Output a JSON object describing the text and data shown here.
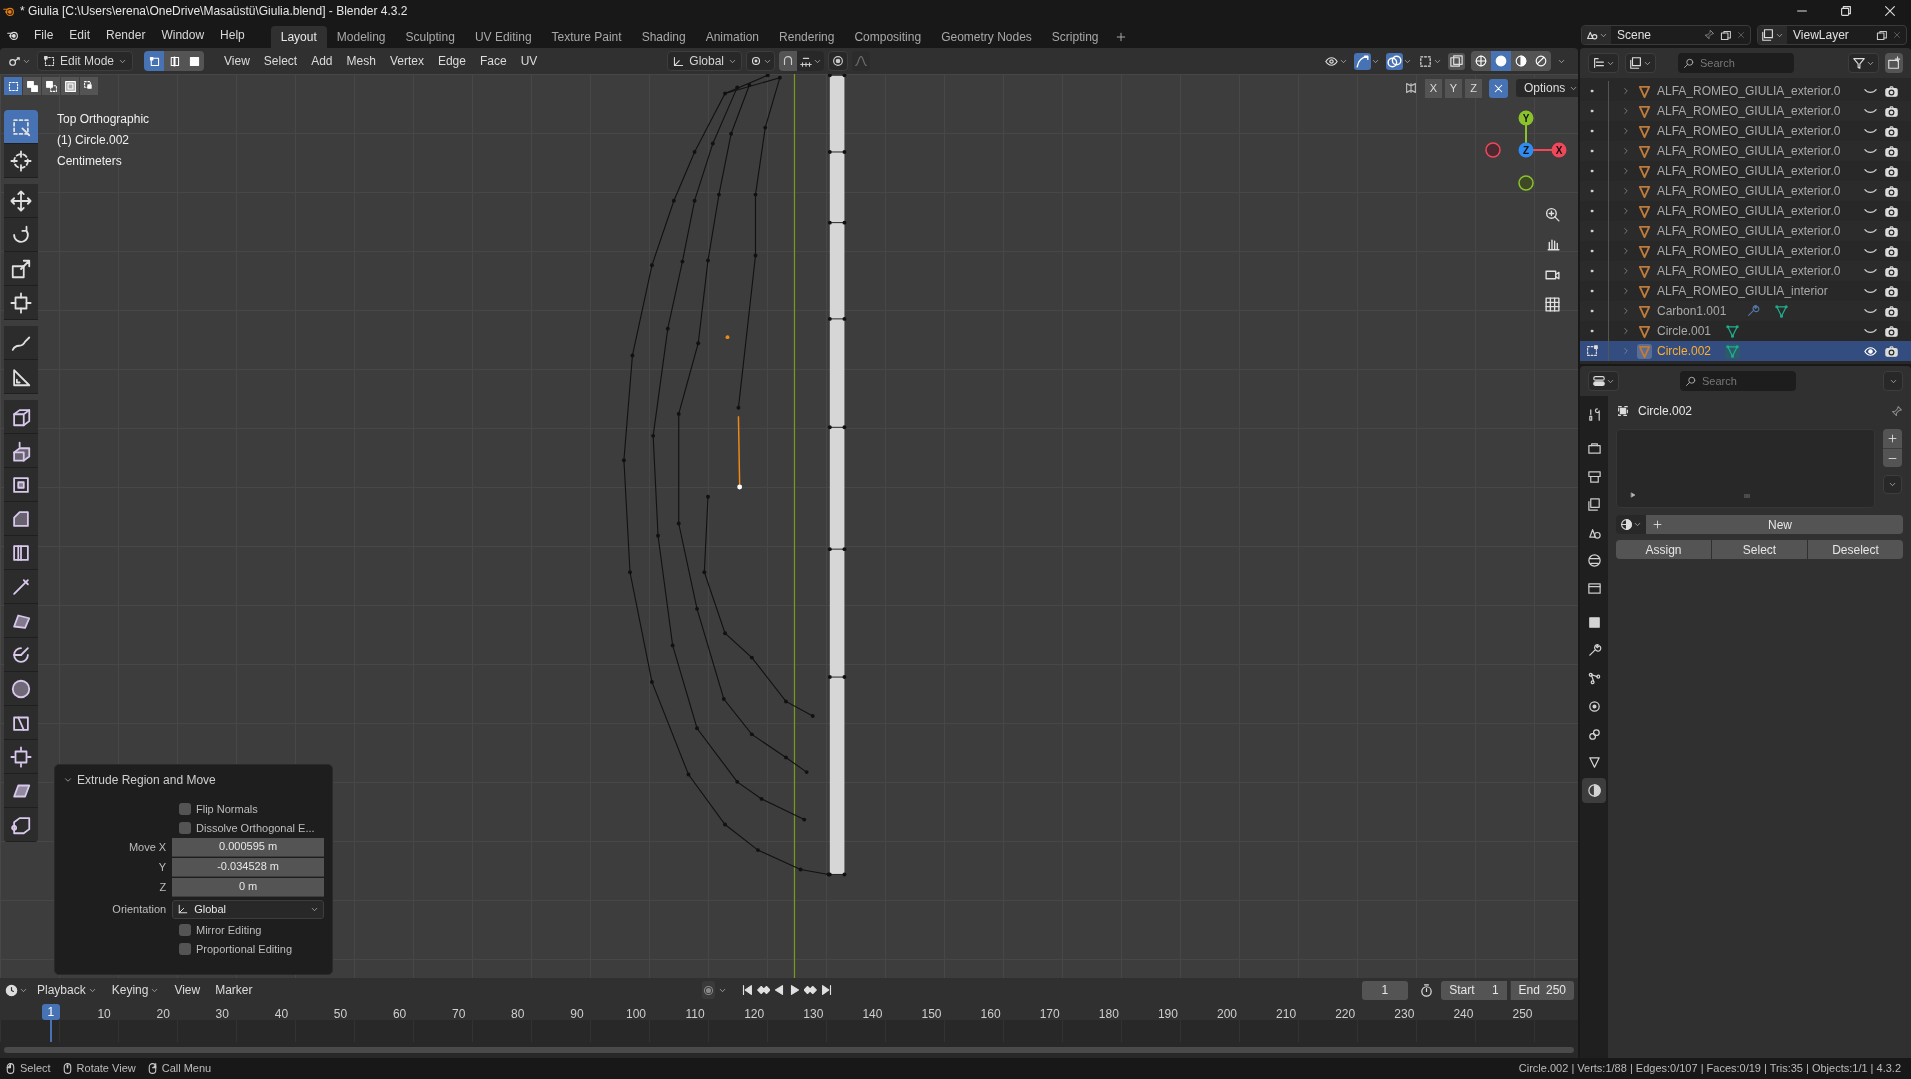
{
  "window": {
    "title": "* Giulia [C:\\Users\\erena\\OneDrive\\Masaüstü\\Giulia.blend] - Blender 4.3.2"
  },
  "menu": [
    "File",
    "Edit",
    "Render",
    "Window",
    "Help"
  ],
  "workspaces": [
    {
      "label": "Layout",
      "selected": true
    },
    {
      "label": "Modeling",
      "selected": false
    },
    {
      "label": "Sculpting",
      "selected": false
    },
    {
      "label": "UV Editing",
      "selected": false
    },
    {
      "label": "Texture Paint",
      "selected": false
    },
    {
      "label": "Shading",
      "selected": false
    },
    {
      "label": "Animation",
      "selected": false
    },
    {
      "label": "Rendering",
      "selected": false
    },
    {
      "label": "Compositing",
      "selected": false
    },
    {
      "label": "Geometry Nodes",
      "selected": false
    },
    {
      "label": "Scripting",
      "selected": false
    }
  ],
  "scene": "Scene",
  "view_layer": "ViewLayer",
  "viewport_header": {
    "mode": "Edit Mode",
    "select_modes": [
      {
        "selected": true
      },
      {
        "selected": false
      },
      {
        "selected": false
      }
    ],
    "menus": [
      "View",
      "Select",
      "Add",
      "Mesh",
      "Vertex",
      "Edge",
      "Face",
      "UV"
    ],
    "orientation": "Global",
    "shading_modes": [
      {
        "selected": false
      },
      {
        "selected": true
      },
      {
        "selected": false
      },
      {
        "selected": false
      }
    ]
  },
  "viewport": {
    "overlay": [
      "Top Orthographic",
      "(1) Circle.002",
      "Centimeters"
    ],
    "gizmo_axes": [
      "Y",
      "Z",
      "X"
    ],
    "mirror_axes": [
      "X",
      "Y",
      "Z"
    ],
    "options": "Options"
  },
  "toolbar": [
    {
      "selected": true
    },
    {
      "selected": false
    },
    {
      "selected": false
    },
    {
      "selected": false
    },
    {
      "selected": false
    },
    {
      "selected": false
    },
    {
      "selected": false
    },
    {
      "selected": false
    },
    {
      "selected": false
    },
    {
      "selected": false
    },
    {
      "selected": false
    },
    {
      "selected": false
    },
    {
      "selected": false
    },
    {
      "selected": false
    },
    {
      "selected": false
    },
    {
      "selected": false
    },
    {
      "selected": false
    },
    {
      "selected": false
    },
    {
      "selected": false
    },
    {
      "selected": false
    },
    {
      "selected": false
    }
  ],
  "operator_panel": {
    "title": "Extrude Region and Move",
    "expanded": true,
    "options": [
      {
        "kind": "checkbox",
        "label": "Flip Normals",
        "checked": false
      },
      {
        "kind": "checkbox",
        "label": "Dissolve Orthogonal E...",
        "checked": false
      },
      {
        "kind": "number",
        "label": "Move X",
        "value": "0.000595 m"
      },
      {
        "kind": "number",
        "label": "Y",
        "value": "-0.034528 m"
      },
      {
        "kind": "number",
        "label": "Z",
        "value": "0 m"
      },
      {
        "kind": "dropdown",
        "label": "Orientation",
        "value": "Global"
      },
      {
        "kind": "checkbox",
        "label": "Mirror Editing",
        "checked": false
      },
      {
        "kind": "checkbox",
        "label": "Proportional Editing",
        "checked": false
      }
    ]
  },
  "outliner": {
    "search": {
      "placeholder": "Search"
    },
    "rows": [
      {
        "name": "ALFA_ROMEO_GIULIA_exterior.0",
        "selected": false,
        "icons": []
      },
      {
        "name": "ALFA_ROMEO_GIULIA_exterior.0",
        "selected": false,
        "icons": []
      },
      {
        "name": "ALFA_ROMEO_GIULIA_exterior.0",
        "selected": false,
        "icons": []
      },
      {
        "name": "ALFA_ROMEO_GIULIA_exterior.0",
        "selected": false,
        "icons": []
      },
      {
        "name": "ALFA_ROMEO_GIULIA_exterior.0",
        "selected": false,
        "icons": []
      },
      {
        "name": "ALFA_ROMEO_GIULIA_exterior.0",
        "selected": false,
        "icons": []
      },
      {
        "name": "ALFA_ROMEO_GIULIA_exterior.0",
        "selected": false,
        "icons": []
      },
      {
        "name": "ALFA_ROMEO_GIULIA_exterior.0",
        "selected": false,
        "icons": []
      },
      {
        "name": "ALFA_ROMEO_GIULIA_exterior.0",
        "selected": false,
        "icons": []
      },
      {
        "name": "ALFA_ROMEO_GIULIA_exterior.0",
        "selected": false,
        "icons": []
      },
      {
        "name": "ALFA_ROMEO_GIULIA_interior",
        "selected": false,
        "icons": []
      },
      {
        "name": "Carbon1.001",
        "selected": false,
        "icons": [
          {
            "kind": "modifier"
          },
          {
            "kind": "mesh"
          }
        ]
      },
      {
        "name": "Circle.001",
        "selected": false,
        "icons": [
          {
            "kind": "mesh"
          }
        ]
      },
      {
        "name": "Circle.002",
        "selected": true,
        "icons": [
          {
            "kind": "mesh"
          }
        ]
      }
    ]
  },
  "properties": {
    "search": {
      "placeholder": "Search"
    },
    "tabs": [
      {
        "selected": false
      },
      {
        "selected": false
      },
      {
        "selected": false
      },
      {
        "selected": false
      },
      {
        "selected": false
      },
      {
        "selected": false
      },
      {
        "selected": false
      },
      {
        "selected": false
      },
      {
        "selected": false
      },
      {
        "selected": false
      },
      {
        "selected": false
      },
      {
        "selected": false
      },
      {
        "selected": false
      },
      {
        "selected": true
      }
    ],
    "object": "Circle.002",
    "new": "New",
    "actions": [
      "Assign",
      "Select",
      "Deselect"
    ]
  },
  "timeline": {
    "menus": [
      "Playback",
      "Keying",
      "View",
      "Marker"
    ],
    "current_frame": "1",
    "start_label": "Start",
    "start": "1",
    "end_label": "End",
    "end": "250",
    "ticks": [
      "1",
      "10",
      "20",
      "30",
      "40",
      "50",
      "60",
      "70",
      "80",
      "90",
      "100",
      "110",
      "120",
      "130",
      "140",
      "150",
      "160",
      "170",
      "180",
      "190",
      "200",
      "210",
      "220",
      "230",
      "240",
      "250"
    ]
  },
  "status_bar": {
    "hints": [
      "Select",
      "Rotate View",
      "Call Menu"
    ],
    "stats": "Circle.002 | Verts:1/88 | Edges:0/107 | Faces:0/19 | Tris:35 | Objects:1/1 | 4.3.2"
  }
}
